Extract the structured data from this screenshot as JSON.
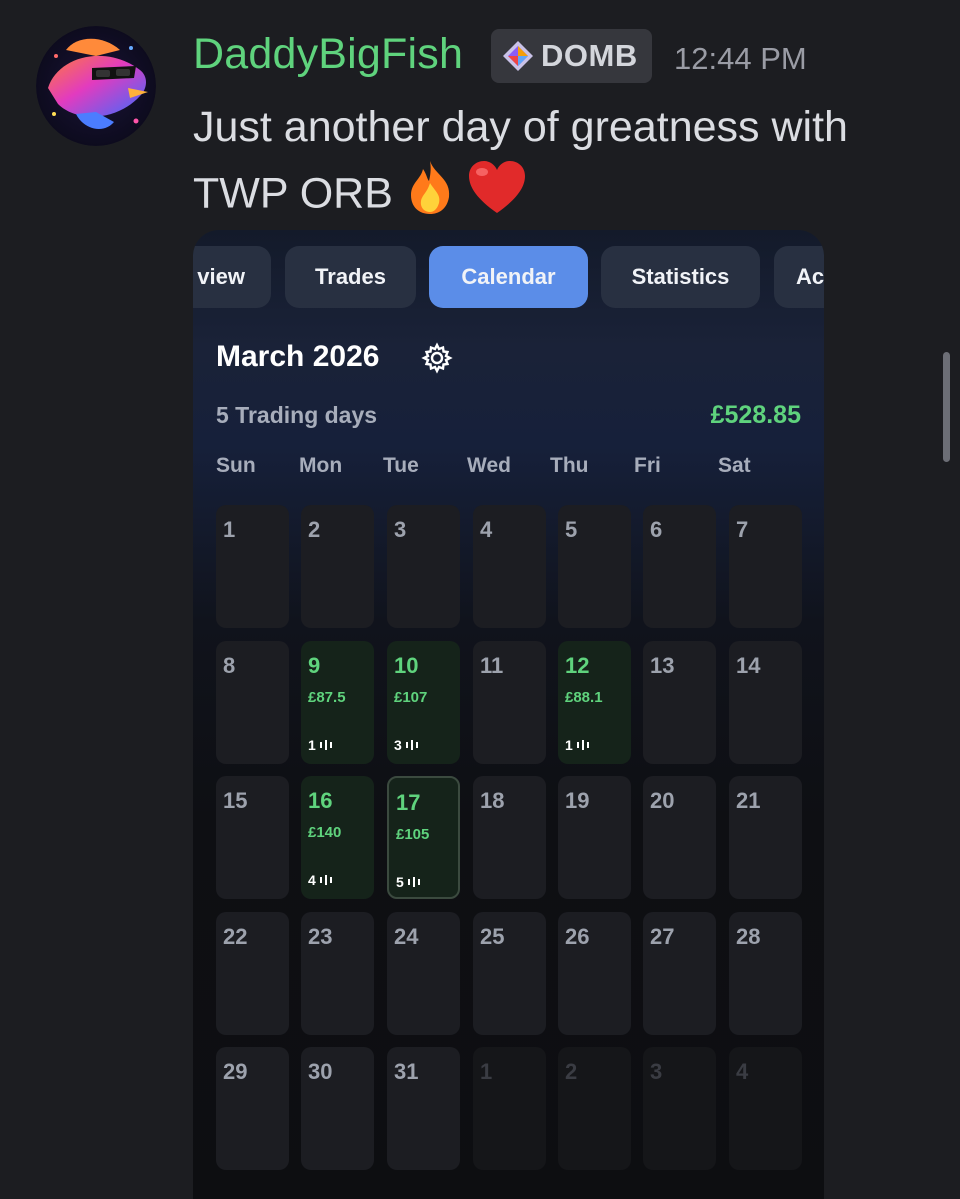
{
  "message": {
    "username": "DaddyBigFish",
    "tag": "DOMB",
    "timestamp": "12:44 PM",
    "text_line1": "Just another day of greatness with",
    "text_line2": "TWP ORB",
    "emojis": [
      "fire-emoji",
      "red-heart-emoji"
    ],
    "colors": {
      "username": "#5fd37d",
      "background": "#1c1d21"
    }
  },
  "app": {
    "tabs": [
      {
        "label": "view",
        "active": false
      },
      {
        "label": "Trades",
        "active": false
      },
      {
        "label": "Calendar",
        "active": true
      },
      {
        "label": "Statistics",
        "active": false
      },
      {
        "label": "Ac",
        "active": false
      }
    ],
    "calendar": {
      "month": "March 2026",
      "trading_days": "5 Trading days",
      "total_pnl": "£528.85",
      "weekdays": [
        "Sun",
        "Mon",
        "Tue",
        "Wed",
        "Thu",
        "Fri",
        "Sat"
      ],
      "weeks": [
        [
          {
            "d": "1"
          },
          {
            "d": "2"
          },
          {
            "d": "3"
          },
          {
            "d": "4"
          },
          {
            "d": "5"
          },
          {
            "d": "6"
          },
          {
            "d": "7"
          }
        ],
        [
          {
            "d": "8"
          },
          {
            "d": "9",
            "pnl": "£87.5",
            "trades": "1"
          },
          {
            "d": "10",
            "pnl": "£107",
            "trades": "3"
          },
          {
            "d": "11"
          },
          {
            "d": "12",
            "pnl": "£88.1",
            "trades": "1"
          },
          {
            "d": "13"
          },
          {
            "d": "14"
          }
        ],
        [
          {
            "d": "15"
          },
          {
            "d": "16",
            "pnl": "£140",
            "trades": "4"
          },
          {
            "d": "17",
            "pnl": "£105",
            "trades": "5",
            "today": true
          },
          {
            "d": "18"
          },
          {
            "d": "19"
          },
          {
            "d": "20"
          },
          {
            "d": "21"
          }
        ],
        [
          {
            "d": "22"
          },
          {
            "d": "23"
          },
          {
            "d": "24"
          },
          {
            "d": "25"
          },
          {
            "d": "26"
          },
          {
            "d": "27"
          },
          {
            "d": "28"
          }
        ],
        [
          {
            "d": "29"
          },
          {
            "d": "30"
          },
          {
            "d": "31"
          },
          {
            "d": "1",
            "other": true
          },
          {
            "d": "2",
            "other": true
          },
          {
            "d": "3",
            "other": true
          },
          {
            "d": "4",
            "other": true
          }
        ]
      ],
      "colors": {
        "profit": "#5fd37d",
        "active_tab": "#5b8de8"
      }
    }
  }
}
